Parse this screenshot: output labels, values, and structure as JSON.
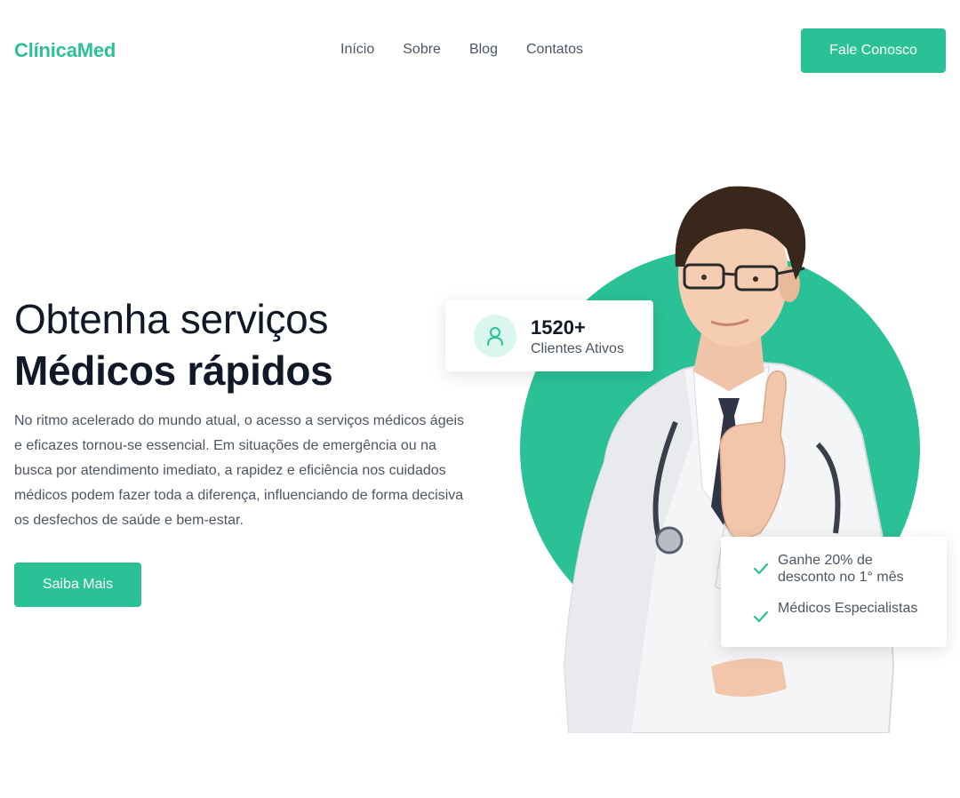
{
  "header": {
    "logo": "ClínicaMed",
    "nav": [
      "Início",
      "Sobre",
      "Blog",
      "Contatos"
    ],
    "cta_label": "Fale Conosco"
  },
  "hero": {
    "title_line1": "Obtenha serviços",
    "title_line2": "Médicos rápidos",
    "description": "No ritmo acelerado do mundo atual, o acesso a serviços médicos ágeis e eficazes tornou-se essencial. Em situações de emergência ou na busca por atendimento imediato, a rapidez e eficiência nos cuidados médicos podem fazer toda a diferença, influenciando de forma decisiva os desfechos de saúde e bem-estar.",
    "cta_label": "Saiba Mais"
  },
  "stat_card": {
    "icon": "user-icon",
    "number": "1520+",
    "label": "Clientes Ativos"
  },
  "benefits": [
    {
      "icon": "check-icon",
      "text": "Ganhe 20% de desconto no 1° mês"
    },
    {
      "icon": "check-icon",
      "text": "Médicos Especialistas"
    }
  ],
  "colors": {
    "accent": "#2bc196",
    "accent_light": "#d9f7ee",
    "heading": "#111827",
    "body_text": "#4b5563"
  }
}
